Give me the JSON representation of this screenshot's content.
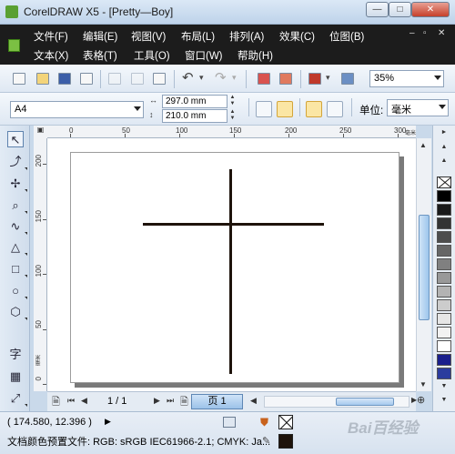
{
  "window": {
    "title": "CorelDRAW X5 - [Pretty—Boy]",
    "minimize": "—",
    "maximize": "□",
    "close": "✕"
  },
  "menu": {
    "row1": [
      "文件(F)",
      "编辑(E)",
      "视图(V)",
      "布局(L)",
      "排列(A)",
      "效果(C)",
      "位图(B)"
    ],
    "row2": [
      "文本(X)",
      "表格(T)",
      "工具(O)",
      "窗口(W)",
      "帮助(H)"
    ],
    "doc_controls": [
      "–",
      "▫",
      "✕"
    ]
  },
  "toolbar": {
    "zoom_value": "35%",
    "icons": [
      "new-icon",
      "open-icon",
      "save-icon",
      "print-icon",
      "cut-icon",
      "copy-icon",
      "paste-icon",
      "undo-icon",
      "redo-icon",
      "import-icon",
      "export-icon",
      "launch-icon",
      "welcome-icon"
    ]
  },
  "property_bar": {
    "paper_size": "A4",
    "width": "297.0 mm",
    "height": "210.0 mm",
    "unit_label": "单位:",
    "unit_value": "毫米",
    "orientation": "landscape"
  },
  "rulers": {
    "corner": "▣",
    "top_labels": [
      "0",
      "50",
      "100",
      "150",
      "200",
      "250",
      "300"
    ],
    "top_unit": "毫米",
    "left_labels": [
      "200",
      "150",
      "100",
      "50",
      "0"
    ],
    "left_unit": "毫米"
  },
  "tools": [
    "pick-tool",
    "shape-tool",
    "crop-tool",
    "zoom-tool",
    "freehand-tool",
    "smart-fill-tool",
    "rectangle-tool",
    "ellipse-tool",
    "polygon-tool",
    "text-tool",
    "table-tool",
    "dimension-tool"
  ],
  "tool_glyphs": [
    "↖",
    "⤴",
    "✢",
    "⌕",
    "∿",
    "△",
    "□",
    "○",
    "⬡",
    "字",
    "▦",
    "⤢"
  ],
  "page_nav": {
    "count": "1 / 1",
    "page_tab": "页 1"
  },
  "palette": {
    "colors": [
      "#ffffff",
      "#000000",
      "#1a1a1a",
      "#333333",
      "#4d4d4d",
      "#666666",
      "#808080",
      "#999999",
      "#b3b3b3",
      "#cccccc",
      "#e6e6e6",
      "#f2f2f2",
      "#ffffff",
      "#1a1f8c",
      "#2b3c9e",
      "#eeeeee"
    ]
  },
  "status": {
    "coords": "( 174.580, 12.396 )",
    "play": "▶",
    "profile": "文档颜色预置文件: RGB: sRGB IEC61966-2.1; CMYK: Ja..."
  },
  "watermark": "Bai百经验",
  "colors": {
    "title_bar": "#bed3ea",
    "menu_bar": "#1c1c1c",
    "page_tab": "#9cc2e9",
    "cross": "#1e130b"
  }
}
